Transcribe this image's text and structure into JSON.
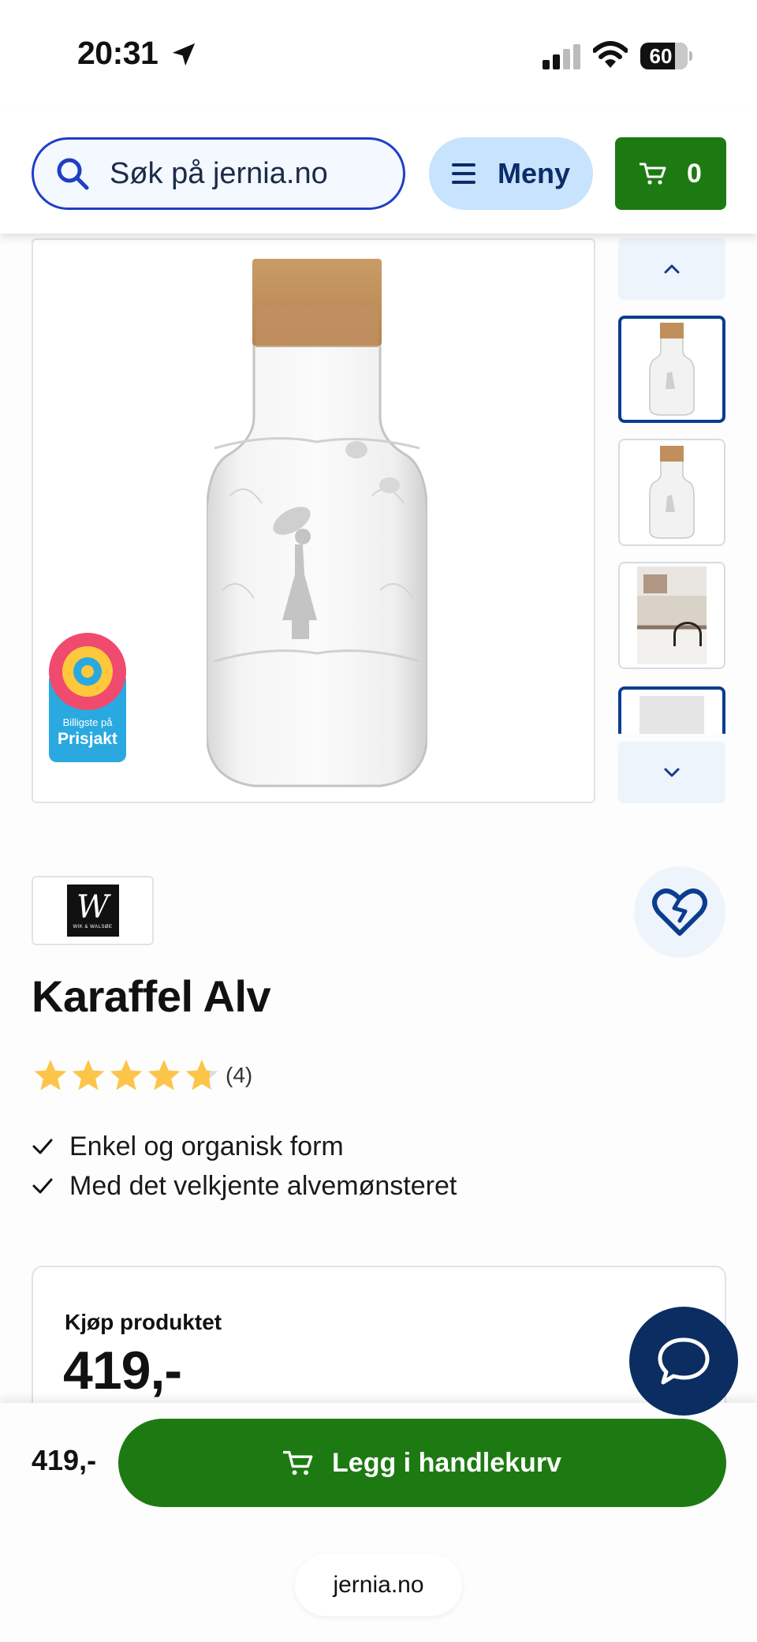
{
  "status_bar": {
    "time": "20:31",
    "battery": "60",
    "icons": [
      "location-arrow-icon",
      "cellular-signal-icon",
      "wifi-icon",
      "battery-icon"
    ]
  },
  "header": {
    "search_placeholder": "Søk på jernia.no",
    "menu_label": "Meny",
    "cart_count": "0"
  },
  "gallery": {
    "badge_line1": "Billigste på",
    "badge_line2": "Prisjakt",
    "thumbnail_count_visible": 4,
    "selected_thumbnail": 1
  },
  "product": {
    "brand_logo_text": "W",
    "brand_logo_subtext": "WIK & WALSØE",
    "title": "Karaffel Alv",
    "rating": 5,
    "rating_max": 5,
    "review_count": "(4)",
    "features": [
      "Enkel og organisk form",
      "Med det velkjente alvemønsteret"
    ]
  },
  "price_card": {
    "label": "Kjøp produktet",
    "price": "419,-"
  },
  "bottom_bar": {
    "price": "419,-",
    "add_to_cart_label": "Legg i handlekurv",
    "url": "jernia.no"
  },
  "colors": {
    "brand_green": "#1d7a12",
    "navy": "#0b2d62",
    "search_border": "#1f3fc4",
    "menu_bg": "#c7e3fd",
    "star": "#fcc54a"
  }
}
